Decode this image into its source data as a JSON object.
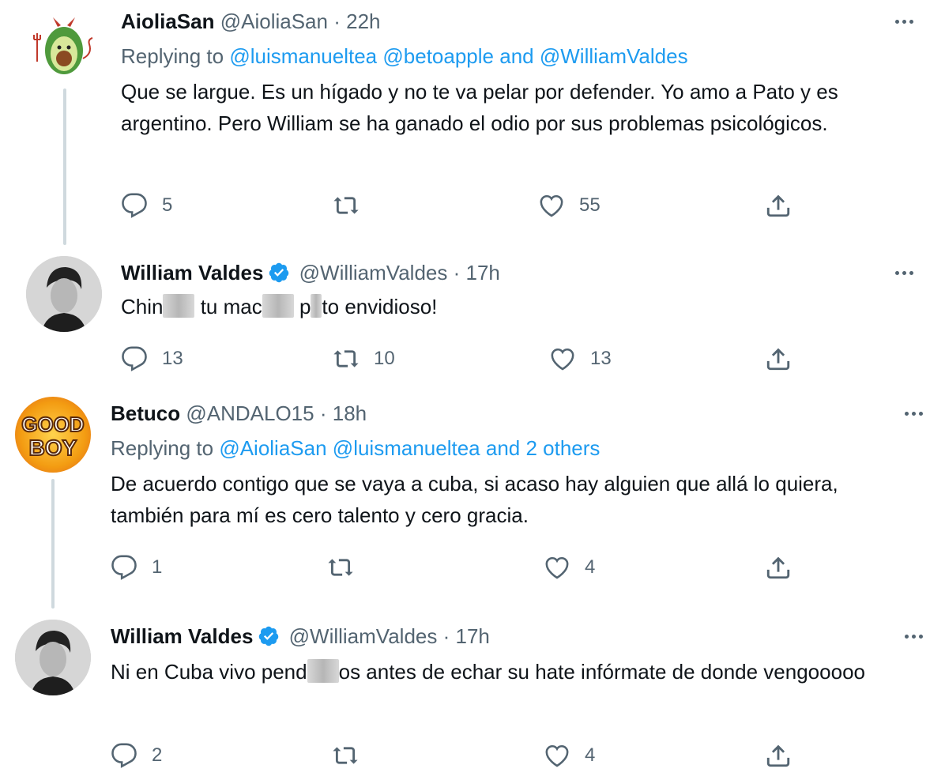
{
  "tweets": [
    {
      "name": "AioliaSan",
      "handle": "@AioliaSan",
      "dot": "·",
      "time": "22h",
      "reply_prefix": "Replying to",
      "reply_users": [
        "@luismanueltea",
        "@betoapple"
      ],
      "reply_and": "and",
      "reply_last": "@WilliamValdes",
      "text": "Que se largue. Es un hígado y no te va pelar por defender. Yo amo a Pato y es argentino. Pero William se ha ganado el odio por sus problemas psicológicos.",
      "replies": "5",
      "retweets": "",
      "likes": "55",
      "avatar_icon": "avocado-devil-icon"
    },
    {
      "name": "William Valdes",
      "handle": "@WilliamValdes",
      "dot": "·",
      "time": "17h",
      "text_parts": [
        "Chin",
        " tu mac",
        " p",
        "to envidioso!"
      ],
      "replies": "13",
      "retweets": "10",
      "likes": "13",
      "verified": true
    },
    {
      "name": "Betuco",
      "handle": "@ANDALO15",
      "dot": "·",
      "time": "18h",
      "reply_prefix": "Replying to",
      "reply_users": [
        "@AioliaSan",
        "@luismanueltea"
      ],
      "reply_and": "and",
      "reply_last": "2 others",
      "text": "De acuerdo contigo que se vaya a cuba, si acaso hay alguien que allá lo quiera, también para mí es cero talento y cero gracia.",
      "replies": "1",
      "retweets": "",
      "likes": "4",
      "avatar_text_1": "GOOD",
      "avatar_text_2": "BOY"
    },
    {
      "name": "William Valdes",
      "handle": "@WilliamValdes",
      "dot": "·",
      "time": "17h",
      "text_parts": [
        "Ni en Cuba vivo pend",
        "os antes de echar su hate infórmate de donde vengooooo"
      ],
      "replies": "2",
      "retweets": "",
      "likes": "4",
      "verified": true
    }
  ],
  "colors": {
    "text": "#0f1419",
    "secondary": "#536471",
    "link": "#1d9bf0",
    "thread_line": "#cfd9de",
    "verified": "#1d9bf0"
  }
}
